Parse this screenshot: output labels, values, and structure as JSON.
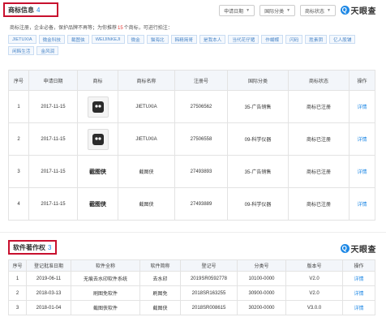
{
  "trademark_section": {
    "title": "商标信息",
    "count": "4",
    "filters": [
      "申请日期",
      "国际分类",
      "商标状态"
    ],
    "hint_prefix": "商标注册，企业必备，保护品牌不再等；为你推荐",
    "hint_num": "15",
    "hint_suffix": "个商标，可进行拍注：",
    "tags": [
      "JIETUXIA",
      "微金科技",
      "截图侠",
      "WEIJINKEJI",
      "微金",
      "猫海北",
      "韩精简哥",
      "是我本人",
      "当代花仔猪",
      "作蝴蝶",
      "闪码",
      "胜素阴",
      "亿人股铺",
      "闲韩生活",
      "金风润"
    ],
    "columns": [
      "序号",
      "申请日期",
      "商标",
      "商标名称",
      "注册号",
      "国际分类",
      "商标状态",
      "操作"
    ],
    "rows": [
      {
        "no": "1",
        "date": "2017-11-15",
        "logo_type": "image",
        "logo_text": "",
        "name": "JIETUXIA",
        "reg": "27506562",
        "cls": "35-广告销售",
        "status": "商标已注册",
        "action": "详情"
      },
      {
        "no": "2",
        "date": "2017-11-15",
        "logo_type": "image",
        "logo_text": "",
        "name": "JIETUXIA",
        "reg": "27506558",
        "cls": "09-科学仪器",
        "status": "商标已注册",
        "action": "详情"
      },
      {
        "no": "3",
        "date": "2017-11-15",
        "logo_type": "text",
        "logo_text": "截图侠",
        "name": "截图侠",
        "reg": "27493893",
        "cls": "35-广告销售",
        "status": "商标已注册",
        "action": "详情"
      },
      {
        "no": "4",
        "date": "2017-11-15",
        "logo_type": "text",
        "logo_text": "截图侠",
        "name": "截图侠",
        "reg": "27493889",
        "cls": "09-科学仪器",
        "status": "商标已注册",
        "action": "详情"
      }
    ]
  },
  "software_section": {
    "title": "软件著作权",
    "count": "3",
    "columns": [
      "序号",
      "登记批准日期",
      "软件全称",
      "软件简称",
      "登记号",
      "分类号",
      "版本号",
      "操作"
    ],
    "rows": [
      {
        "no": "1",
        "date": "2019-06-11",
        "full": "无痕去水印软件系统",
        "short": "去水印",
        "reg": "2019SR0592778",
        "cls": "10100-0000",
        "ver": "V2.0",
        "action": "详情"
      },
      {
        "no": "2",
        "date": "2018-03-13",
        "full": "刷图免软件",
        "short": "刷图免",
        "reg": "2018SR163255",
        "cls": "30900-0000",
        "ver": "V2.0",
        "action": "详情"
      },
      {
        "no": "3",
        "date": "2018-01-04",
        "full": "截图侠软件",
        "short": "截图侠",
        "reg": "2018SR008615",
        "cls": "30200-0000",
        "ver": "V3.0.0",
        "action": "详情"
      }
    ]
  },
  "brand": {
    "name": "天眼查",
    "mark": "Q"
  },
  "colors": {
    "accent": "#1e88e5",
    "highlight_border": "#c8102e",
    "header_bg": "#f3f6fa",
    "red_number": "#e53935"
  }
}
